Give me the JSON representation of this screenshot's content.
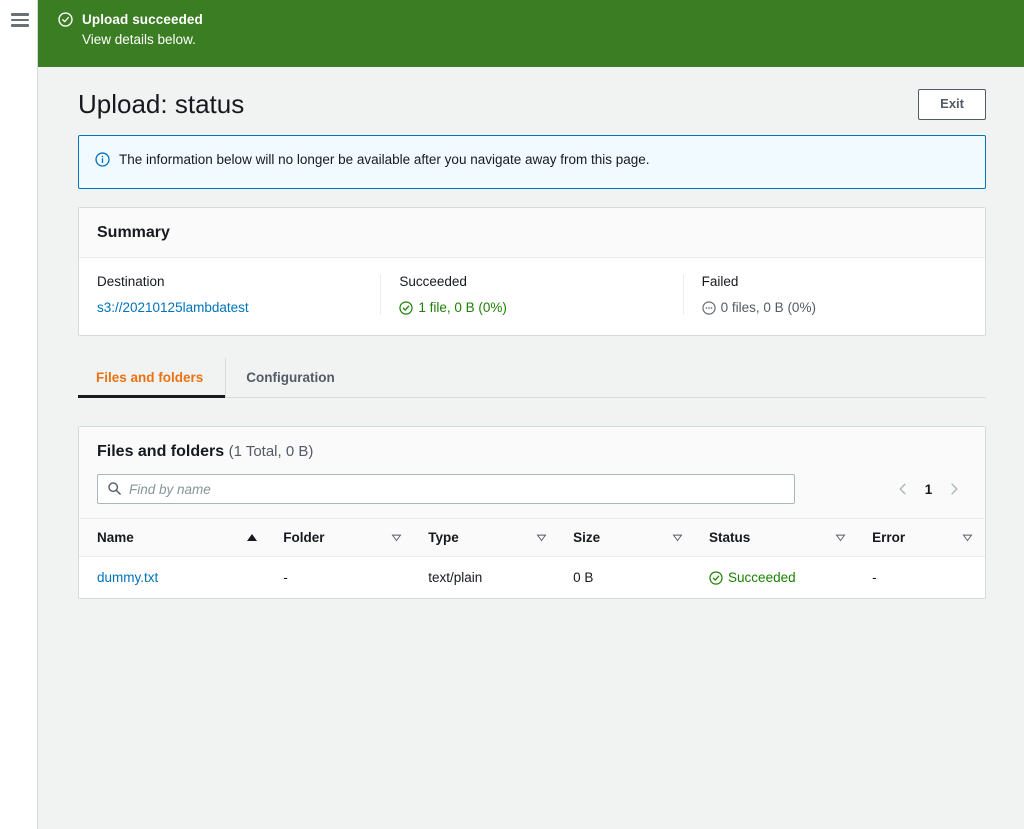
{
  "nav": {
    "menu_icon": "hamburger-menu-icon"
  },
  "flash": {
    "icon": "status-success-icon",
    "title": "Upload succeeded",
    "subtitle": "View details below.",
    "color": "#3b7d23"
  },
  "header": {
    "title": "Upload: status",
    "exit_label": "Exit"
  },
  "alert": {
    "icon": "status-info-icon",
    "text": "The information below will no longer be available after you navigate away from this page.",
    "border_color": "#0073bb",
    "background_color": "#f1faff"
  },
  "summary": {
    "heading": "Summary",
    "items": [
      {
        "label": "Destination",
        "value": "s3://20210125lambdatest",
        "kind": "link",
        "icon": null
      },
      {
        "label": "Succeeded",
        "value": "1 file, 0 B (0%)",
        "kind": "success",
        "icon": "status-success-icon",
        "color": "#1d8102"
      },
      {
        "label": "Failed",
        "value": "0 files, 0 B (0%)",
        "kind": "muted",
        "icon": "status-pending-icon",
        "color": "#545b64"
      }
    ]
  },
  "tabs": [
    {
      "label": "Files and folders",
      "active": true
    },
    {
      "label": "Configuration",
      "active": false
    }
  ],
  "table_panel": {
    "title": "Files and folders",
    "count": "(1 Total, 0 B)",
    "search": {
      "icon": "search-icon",
      "placeholder": "Find by name",
      "value": ""
    },
    "pagination": {
      "prev_icon": "chevron-left-icon",
      "page": "1",
      "next_icon": "chevron-right-icon"
    },
    "columns": [
      {
        "label": "Name",
        "sort": "asc",
        "sort_icon": "sort-ascending-icon"
      },
      {
        "label": "Folder",
        "sort": "none",
        "sort_icon": "sort-icon"
      },
      {
        "label": "Type",
        "sort": "none",
        "sort_icon": "sort-icon"
      },
      {
        "label": "Size",
        "sort": "none",
        "sort_icon": "sort-icon"
      },
      {
        "label": "Status",
        "sort": "none",
        "sort_icon": "sort-icon"
      },
      {
        "label": "Error",
        "sort": "none",
        "sort_icon": "sort-icon"
      }
    ],
    "rows": [
      {
        "name": "dummy.txt",
        "folder": "-",
        "type": "text/plain",
        "size": "0 B",
        "status": "Succeeded",
        "status_icon": "status-success-icon",
        "error": "-"
      }
    ]
  },
  "colors": {
    "accent_orange": "#ec7211",
    "link_blue": "#0073bb",
    "success_green": "#1d8102",
    "banner_green": "#3b7d23",
    "page_background": "#f1f3f3"
  }
}
